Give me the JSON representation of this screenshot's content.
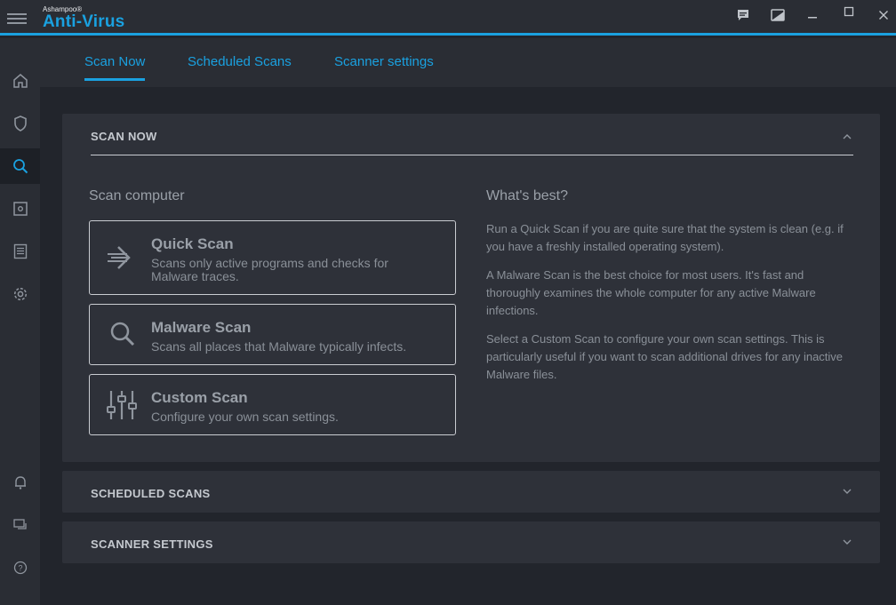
{
  "app": {
    "vendor": "Ashampoo®",
    "name": "Anti-Virus"
  },
  "tabs": [
    {
      "label": "Scan Now",
      "active": true
    },
    {
      "label": "Scheduled Scans",
      "active": false
    },
    {
      "label": "Scanner settings",
      "active": false
    }
  ],
  "sidebar": {
    "items": [
      {
        "icon": "home-icon"
      },
      {
        "icon": "shield-icon"
      },
      {
        "icon": "search-icon",
        "active": true
      },
      {
        "icon": "quarantine-icon"
      },
      {
        "icon": "log-icon"
      },
      {
        "icon": "gear-icon"
      },
      {
        "icon": "bell-icon"
      },
      {
        "icon": "chat-icon"
      },
      {
        "icon": "help-icon"
      }
    ]
  },
  "scan_now": {
    "header": "SCAN NOW",
    "scan_heading": "Scan computer",
    "options": [
      {
        "title": "Quick Scan",
        "desc": "Scans only active programs and checks for Malware traces.",
        "icon": "arrow-icon"
      },
      {
        "title": "Malware Scan",
        "desc": "Scans all places that Malware typically infects.",
        "icon": "magnifier-icon"
      },
      {
        "title": "Custom Scan",
        "desc": "Configure your own scan settings.",
        "icon": "sliders-icon"
      }
    ],
    "best_heading": "What's best?",
    "best_paragraphs": [
      "Run a Quick Scan if you are quite sure that the system is clean (e.g. if you have a freshly installed operating system).",
      "A Malware Scan is the best choice for most users. It's fast and thoroughly examines the whole computer for any active Malware infections.",
      "Select a Custom Scan to configure your own scan settings. This is particularly useful if you want to scan additional drives for any inactive Malware files."
    ]
  },
  "scheduled_scans": {
    "header": "SCHEDULED SCANS"
  },
  "scanner_settings": {
    "header": "SCANNER SETTINGS"
  },
  "colors": {
    "accent": "#1aa1e0",
    "background": "#22252c",
    "panel": "#2e3139"
  }
}
